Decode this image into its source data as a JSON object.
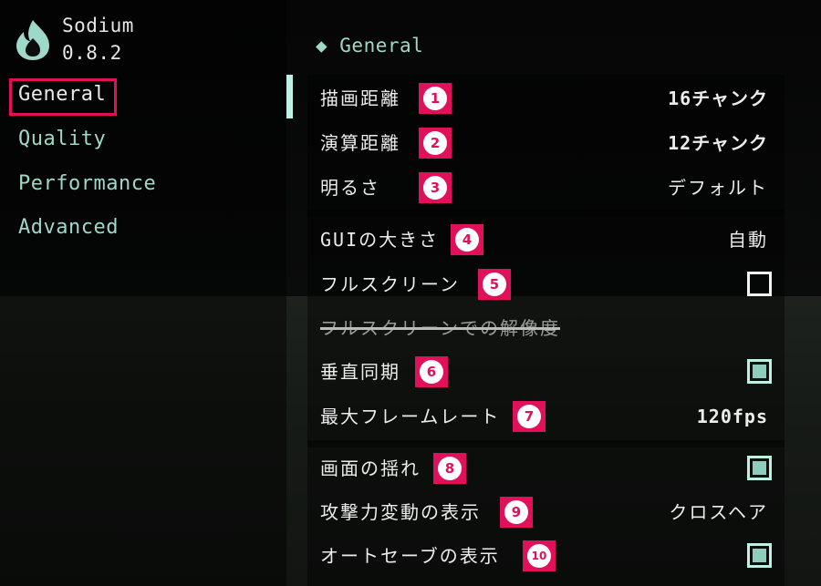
{
  "app": {
    "name": "Sodium",
    "version": "0.8.2",
    "logo_icon": "flame-icon",
    "accent_color": "#9ed8c8",
    "highlight_color": "#e0105a"
  },
  "sidebar": {
    "items": [
      {
        "label": "General",
        "active": true
      },
      {
        "label": "Quality",
        "active": false
      },
      {
        "label": "Performance",
        "active": false
      },
      {
        "label": "Advanced",
        "active": false
      }
    ]
  },
  "section": {
    "title": "◆ General"
  },
  "settings": [
    {
      "label": "描画距離",
      "badge": "1",
      "value": "16チャンク",
      "type": "slider"
    },
    {
      "label": "演算距離",
      "badge": "2",
      "value": "12チャンク",
      "type": "slider"
    },
    {
      "label": "明るさ",
      "badge": "3",
      "value": "デフォルト",
      "type": "slider"
    },
    {
      "label": "GUIの大きさ",
      "badge": "4",
      "value": "自動",
      "type": "cycle"
    },
    {
      "label": "フルスクリーン",
      "badge": "5",
      "value": "",
      "type": "checkbox",
      "checked": false
    },
    {
      "label": "フルスクリーンでの解像度",
      "badge": "",
      "value": "",
      "type": "disabled"
    },
    {
      "label": "垂直同期",
      "badge": "6",
      "value": "",
      "type": "checkbox",
      "checked": true
    },
    {
      "label": "最大フレームレート",
      "badge": "7",
      "value": "120fps",
      "type": "slider"
    },
    {
      "label": "画面の揺れ",
      "badge": "8",
      "value": "",
      "type": "checkbox",
      "checked": true
    },
    {
      "label": "攻撃力変動の表示",
      "badge": "9",
      "value": "クロスヘア",
      "type": "cycle"
    },
    {
      "label": "オートセーブの表示",
      "badge": "10",
      "value": "",
      "type": "checkbox",
      "checked": true
    }
  ]
}
